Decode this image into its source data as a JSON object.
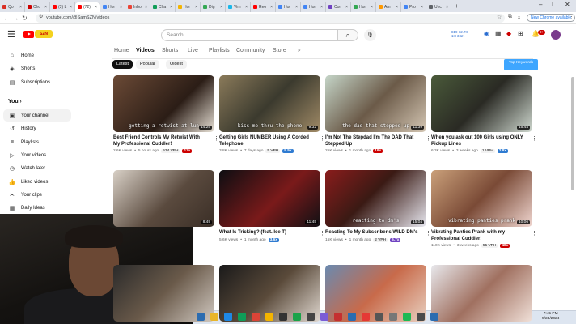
{
  "browser": {
    "tabs": [
      {
        "label": "Qo",
        "color": "#d93025"
      },
      {
        "label": "Cho",
        "color": "#cc0000"
      },
      {
        "label": "(3) L",
        "color": "#ff0000"
      },
      {
        "label": "(72)",
        "color": "#ff0000",
        "active": true
      },
      {
        "label": "Hor",
        "color": "#4285f4"
      },
      {
        "label": "Inbo",
        "color": "#ea4335"
      },
      {
        "label": "Cha",
        "color": "#0f9d58"
      },
      {
        "label": "Hor",
        "color": "#f4b400"
      },
      {
        "label": "Dig",
        "color": "#34a853"
      },
      {
        "label": "Vim",
        "color": "#1ab7ea"
      },
      {
        "label": "Reo",
        "color": "#ff0000"
      },
      {
        "label": "Hor",
        "color": "#4285f4"
      },
      {
        "label": "Hor",
        "color": "#4285f4"
      },
      {
        "label": "Cor",
        "color": "#6f42c1"
      },
      {
        "label": "Hor",
        "color": "#34a853"
      },
      {
        "label": "Am",
        "color": "#ff9900"
      },
      {
        "label": "Pro",
        "color": "#4285f4"
      },
      {
        "label": "Unc",
        "color": "#5f6368"
      }
    ],
    "new_tab": "+",
    "url": "youtube.com/@SamSZN/videos",
    "new_chrome": "New Chrome available"
  },
  "header": {
    "search_placeholder": "Search",
    "logo_text": "SZN",
    "stats_line1": "819  12.7K",
    "stats_line2": "1H  3.1K",
    "notif_count": "9+"
  },
  "sidebar": {
    "items": [
      {
        "label": "Home",
        "icon": "home-icon",
        "glyph": "⌂"
      },
      {
        "label": "Shorts",
        "icon": "shorts-icon",
        "glyph": "◈"
      },
      {
        "label": "Subscriptions",
        "icon": "subscriptions-icon",
        "glyph": "▤"
      }
    ],
    "you_heading": "You",
    "you_items": [
      {
        "label": "Your channel",
        "icon": "channel-icon",
        "glyph": "▣",
        "active": true
      },
      {
        "label": "History",
        "icon": "history-icon",
        "glyph": "↺"
      },
      {
        "label": "Playlists",
        "icon": "playlists-icon",
        "glyph": "≡"
      },
      {
        "label": "Your videos",
        "icon": "your-videos-icon",
        "glyph": "▷"
      },
      {
        "label": "Watch later",
        "icon": "watch-later-icon",
        "glyph": "◷"
      },
      {
        "label": "Liked videos",
        "icon": "liked-icon",
        "glyph": "👍"
      },
      {
        "label": "Your clips",
        "icon": "clips-icon",
        "glyph": "✂"
      },
      {
        "label": "Daily Ideas",
        "icon": "ideas-icon",
        "glyph": "▦"
      }
    ]
  },
  "channel_nav": {
    "tabs": [
      "Home",
      "Videos",
      "Shorts",
      "Live",
      "Playlists",
      "Community",
      "Store"
    ],
    "active": "Videos"
  },
  "filters": {
    "chips": [
      "Latest",
      "Popular",
      "Oldest"
    ],
    "active": "Latest",
    "top_keywords": "Top Keywords"
  },
  "videos": [
    {
      "title": "Best Friend Controls My Retwist With My Professional Cuddler!",
      "views": "2.6K views",
      "age": "5 hours ago",
      "vph": "534 VPH",
      "badge": "13x",
      "badge_color": "#cc0000",
      "duration": "14:25",
      "caption": "getting a retwist at lun",
      "bg": "linear-gradient(135deg,#6b4a36,#2b1d16 60%,#e8e1d6)"
    },
    {
      "title": "Getting Girls NUMBER Using A Corded Telephone",
      "views": "3.8K views",
      "age": "7 days ago",
      "vph": "5 VPH",
      "badge": "5.5x",
      "badge_color": "#2f7bd1",
      "duration": "9:32",
      "caption": "kiss me thru the phone",
      "bg": "linear-gradient(135deg,#8a7a5a,#3b3a2e 50%,#a08a66)"
    },
    {
      "title": "I'm Not The Stepdad I'm The DAD That Stepped Up",
      "views": "25K views",
      "age": "1 month ago",
      "vph": "",
      "badge": "19x",
      "badge_color": "#cc0000",
      "duration": "11:39",
      "caption": "the dad that stepped up",
      "bg": "linear-gradient(135deg,#c5d5c8,#6b5a48 50%,#d4c6b3)"
    },
    {
      "title": "When you ask out 100 Girls using ONLY Pickup Lines",
      "views": "6.3K views",
      "age": "3 weeks ago",
      "vph": "1 VPH",
      "badge": "2.8x",
      "badge_color": "#2f7bd1",
      "duration": "15:44",
      "caption": "",
      "bg": "linear-gradient(135deg,#4a5a3a,#2a2a24 50%,#cfd8cf)"
    },
    {
      "title": "",
      "views": "",
      "age": "",
      "vph": "",
      "badge": "",
      "badge_color": "#cc0000",
      "duration": "8:49",
      "caption": "",
      "bg": "linear-gradient(135deg,#d8d0c6,#5a4a3e 55%,#3a2e26)"
    },
    {
      "title": "What Is Tricking? (feat. Ice T)",
      "views": "5.6K views",
      "age": "1 month ago",
      "vph": "",
      "badge": "3.6x",
      "badge_color": "#2f7bd1",
      "duration": "11:45",
      "caption": "",
      "bg": "linear-gradient(135deg,#0e0e12,#7a1a1a 55%,#101014)"
    },
    {
      "title": "Reacting To My Subscriber's WILD DM's",
      "views": "15K views",
      "age": "1 month ago",
      "vph": "2 VPH",
      "badge": "6.7x",
      "badge_color": "#6f42c1",
      "duration": "15:04",
      "caption": "reacting to dm's",
      "bg": "linear-gradient(135deg,#8a1c1c,#3a1a14 45%,#e8e8f0)"
    },
    {
      "title": "Vibrating Panties Prank with my Professional Cuddler!",
      "views": "110K views",
      "age": "3 weeks ago",
      "vph": "55 VPH",
      "badge": "48x",
      "badge_color": "#cc0000",
      "duration": "10:06",
      "caption": "vibrating panties prank",
      "bg": "linear-gradient(135deg,#caa07a,#7a4a36 50%,#f0d6d0)"
    },
    {
      "title": "",
      "views": "",
      "age": "",
      "vph": "",
      "badge": "",
      "badge_color": "#cc0000",
      "duration": "",
      "caption": "",
      "bg": "linear-gradient(135deg,#2a2a2a,#6a5a4a 50%,#d0c8c0)"
    },
    {
      "title": "",
      "views": "",
      "age": "",
      "vph": "",
      "badge": "",
      "badge_color": "#cc0000",
      "duration": "",
      "caption": "",
      "bg": "linear-gradient(135deg,#1a1a1a,#5a4a3a 50%,#e0d8d0)"
    },
    {
      "title": "",
      "views": "",
      "age": "",
      "vph": "",
      "badge": "",
      "badge_color": "#cc0000",
      "duration": "",
      "caption": "",
      "bg": "linear-gradient(135deg,#6a8ab0,#c86a4a 50%,#e8d0c0)"
    },
    {
      "title": "",
      "views": "",
      "age": "",
      "vph": "",
      "badge": "",
      "badge_color": "#cc0000",
      "duration": "",
      "caption": "",
      "bg": "linear-gradient(135deg,#e8e8ec,#a07060 50%,#f0e0d8)"
    }
  ],
  "taskbar": {
    "time": "7:45 PM",
    "date": "5/24/2024",
    "apps": [
      "#2b6cb0",
      "#e8b52a",
      "#1e88e5",
      "#0f9d58",
      "#db4437",
      "#f4b400",
      "#333333",
      "#1aa34a",
      "#444444",
      "#7b5cd6",
      "#c53030",
      "#2b6cb0",
      "#e53935",
      "#555555",
      "#777777",
      "#1db954",
      "#4a4a4a",
      "#2b6cb0"
    ]
  }
}
